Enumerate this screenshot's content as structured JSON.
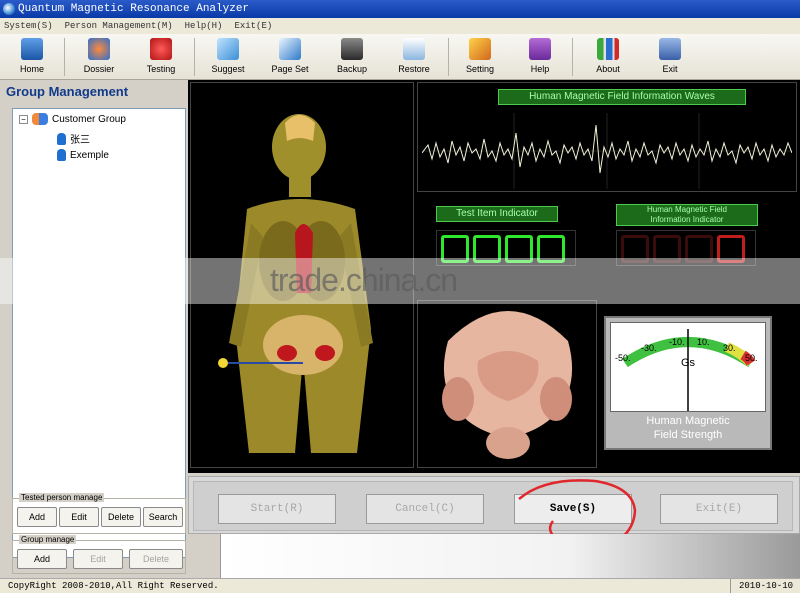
{
  "window": {
    "title": "Quantum Magnetic Resonance Analyzer"
  },
  "menu": [
    "System(S)",
    "Person Management(M)",
    "Help(H)",
    "Exit(E)"
  ],
  "toolbar": [
    {
      "label": "Home",
      "icon": "home-icon"
    },
    {
      "label": "Dossier",
      "icon": "dossier-icon"
    },
    {
      "label": "Testing",
      "icon": "testing-icon"
    },
    {
      "label": "Suggest",
      "icon": "suggest-icon"
    },
    {
      "label": "Page Set",
      "icon": "page-set-icon"
    },
    {
      "label": "Backup",
      "icon": "backup-icon"
    },
    {
      "label": "Restore",
      "icon": "restore-icon"
    },
    {
      "label": "Setting",
      "icon": "setting-icon"
    },
    {
      "label": "Help",
      "icon": "help-icon"
    },
    {
      "label": "About",
      "icon": "about-icon"
    },
    {
      "label": "Exit",
      "icon": "exit-icon"
    }
  ],
  "sidebar": {
    "title": "Group Management",
    "tree": {
      "group": "Customer Group",
      "persons": [
        "张三",
        "Exemple"
      ]
    },
    "tested_person": {
      "legend": "Tested person manage",
      "buttons": [
        "Add",
        "Edit",
        "Delete",
        "Search"
      ]
    },
    "group_manage": {
      "legend": "Group manage",
      "buttons": [
        "Add",
        "Edit",
        "Delete"
      ]
    }
  },
  "panels": {
    "wave_title": "Human Magnetic Field Information Waves",
    "test_item_title": "Test Item Indicator",
    "field_info_title_1": "Human Magnetic Field",
    "field_info_title_2": "Information Indicator",
    "gauge_ticks": [
      "-50.",
      "-30.",
      "-10.",
      "10.",
      "30.",
      "50."
    ],
    "gauge_unit": "Gs",
    "gauge_label_1": "Human Magnetic",
    "gauge_label_2": "Field Strength"
  },
  "watermark": "trade.china.cn",
  "actions": [
    "Start(R)",
    "Cancel(C)",
    "Save(S)",
    "Exit(E)"
  ],
  "status": {
    "copyright": "CopyRight 2008-2010,All Right Reserved.",
    "date": "2010-10-10"
  },
  "colors": {
    "titlebar": "#0a3aa8",
    "lcd_green": "#2ee82e",
    "lcd_red": "#c01d1d",
    "annotation": "#e0282c"
  }
}
